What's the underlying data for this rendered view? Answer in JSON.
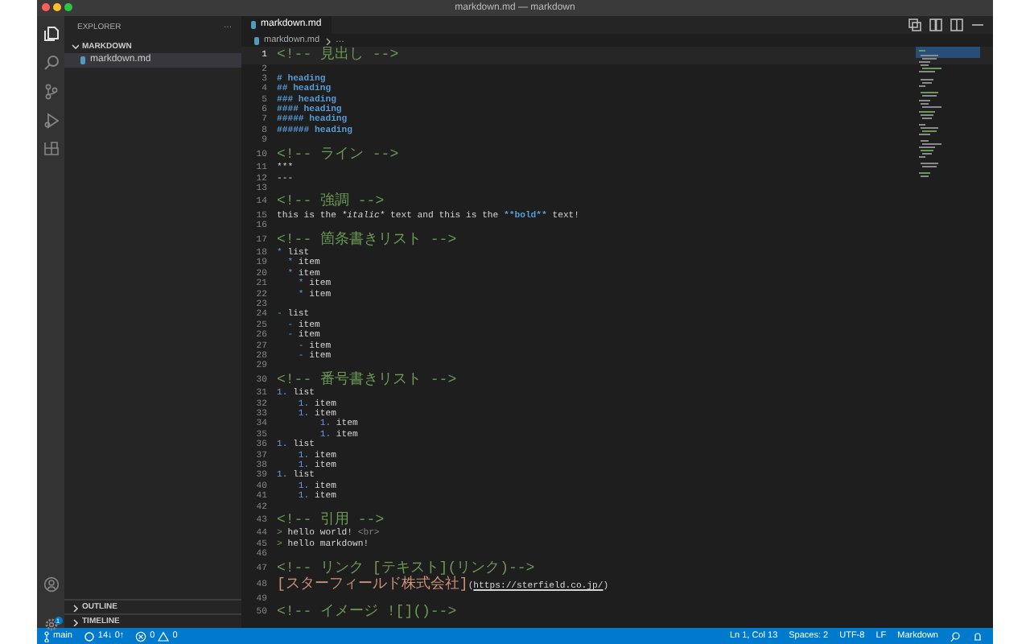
{
  "window": {
    "title": "markdown.md — markdown"
  },
  "activity_bar": {
    "items": [
      {
        "kind": "files",
        "selected": true
      },
      {
        "kind": "search",
        "selected": false
      },
      {
        "kind": "source-control",
        "selected": false
      },
      {
        "kind": "run",
        "selected": false
      },
      {
        "kind": "extensions",
        "selected": false
      }
    ],
    "settings_badge": "1"
  },
  "sidebar": {
    "title": "EXPLORER",
    "more": "···",
    "folder": {
      "label": "MARKDOWN",
      "expanded": true,
      "files": [
        {
          "name": "markdown.md",
          "selected": true
        }
      ]
    },
    "sections": [
      {
        "label": "OUTLINE",
        "expanded": false
      },
      {
        "label": "TIMELINE",
        "expanded": false
      }
    ]
  },
  "editor": {
    "tab": {
      "label": "markdown.md"
    },
    "breadcrumb": [
      "markdown.md",
      "…"
    ],
    "lines": [
      {
        "number": "1",
        "current": true,
        "segments": [
          {
            "kind": "comment",
            "text": "<!-- 見出し -->"
          }
        ]
      },
      {
        "number": "2",
        "current": false
      },
      {
        "number": "3",
        "current": false,
        "segments": [
          {
            "kind": "heading",
            "text": "# heading"
          }
        ]
      },
      {
        "number": "4",
        "current": false,
        "segments": [
          {
            "kind": "heading",
            "text": "## heading"
          }
        ]
      },
      {
        "number": "5",
        "current": false,
        "segments": [
          {
            "kind": "heading",
            "text": "### heading"
          }
        ]
      },
      {
        "number": "6",
        "current": false,
        "segments": [
          {
            "kind": "heading",
            "text": "#### heading"
          }
        ]
      },
      {
        "number": "7",
        "current": false,
        "segments": [
          {
            "kind": "heading",
            "text": "##### heading"
          }
        ]
      },
      {
        "number": "8",
        "current": false,
        "segments": [
          {
            "kind": "heading",
            "text": "###### heading"
          }
        ]
      },
      {
        "number": "9",
        "current": false
      },
      {
        "number": "10",
        "current": false,
        "segments": [
          {
            "kind": "comment",
            "text": "<!-- ライン -->"
          }
        ]
      },
      {
        "number": "11",
        "current": false,
        "segments": [
          {
            "kind": "text",
            "text": "***"
          }
        ]
      },
      {
        "number": "12",
        "current": false,
        "segments": [
          {
            "kind": "text",
            "text": "---"
          }
        ]
      },
      {
        "number": "13",
        "current": false
      },
      {
        "number": "14",
        "current": false,
        "segments": [
          {
            "kind": "comment",
            "text": "<!-- 強調 -->"
          }
        ]
      },
      {
        "number": "15",
        "current": false,
        "segments": [
          {
            "kind": "text",
            "text": "this is the "
          },
          {
            "kind": "italic",
            "text": "*italic*"
          },
          {
            "kind": "text",
            "text": " text and this is the "
          },
          {
            "kind": "bold",
            "text": "**bold**"
          },
          {
            "kind": "text",
            "text": " text!"
          }
        ]
      },
      {
        "number": "16",
        "current": false
      },
      {
        "number": "17",
        "current": false,
        "segments": [
          {
            "kind": "comment",
            "text": "<!-- 箇条書きリスト -->"
          }
        ]
      },
      {
        "number": "18",
        "current": false,
        "segments": [
          {
            "kind": "marker",
            "text": "*"
          },
          {
            "kind": "text",
            "text": " list"
          }
        ]
      },
      {
        "number": "19",
        "current": false,
        "segments": [
          {
            "kind": "marker",
            "text": "  *"
          },
          {
            "kind": "text",
            "text": " item"
          }
        ]
      },
      {
        "number": "20",
        "current": false,
        "segments": [
          {
            "kind": "marker",
            "text": "  *"
          },
          {
            "kind": "text",
            "text": " item"
          }
        ]
      },
      {
        "number": "21",
        "current": false,
        "segments": [
          {
            "kind": "marker",
            "text": "    *"
          },
          {
            "kind": "text",
            "text": " item"
          }
        ]
      },
      {
        "number": "22",
        "current": false,
        "segments": [
          {
            "kind": "marker",
            "text": "    *"
          },
          {
            "kind": "text",
            "text": " item"
          }
        ]
      },
      {
        "number": "23",
        "current": false
      },
      {
        "number": "24",
        "current": false,
        "segments": [
          {
            "kind": "marker",
            "text": "-"
          },
          {
            "kind": "text",
            "text": " list"
          }
        ]
      },
      {
        "number": "25",
        "current": false,
        "segments": [
          {
            "kind": "marker",
            "text": "  -"
          },
          {
            "kind": "text",
            "text": " item"
          }
        ]
      },
      {
        "number": "26",
        "current": false,
        "segments": [
          {
            "kind": "marker",
            "text": "  -"
          },
          {
            "kind": "text",
            "text": " item"
          }
        ]
      },
      {
        "number": "27",
        "current": false,
        "segments": [
          {
            "kind": "marker",
            "text": "    -"
          },
          {
            "kind": "text",
            "text": " item"
          }
        ]
      },
      {
        "number": "28",
        "current": false,
        "segments": [
          {
            "kind": "marker",
            "text": "    -"
          },
          {
            "kind": "text",
            "text": " item"
          }
        ]
      },
      {
        "number": "29",
        "current": false
      },
      {
        "number": "30",
        "current": false,
        "segments": [
          {
            "kind": "comment",
            "text": "<!-- 番号書きリスト -->"
          }
        ]
      },
      {
        "number": "31",
        "current": false,
        "segments": [
          {
            "kind": "marker",
            "text": "1."
          },
          {
            "kind": "text",
            "text": " list"
          }
        ]
      },
      {
        "number": "32",
        "current": false,
        "segments": [
          {
            "kind": "marker",
            "text": "    1."
          },
          {
            "kind": "text",
            "text": " item"
          }
        ]
      },
      {
        "number": "33",
        "current": false,
        "segments": [
          {
            "kind": "marker",
            "text": "    1."
          },
          {
            "kind": "text",
            "text": " item"
          }
        ]
      },
      {
        "number": "34",
        "current": false,
        "segments": [
          {
            "kind": "marker",
            "text": "        1."
          },
          {
            "kind": "text",
            "text": " item"
          }
        ]
      },
      {
        "number": "35",
        "current": false,
        "segments": [
          {
            "kind": "marker",
            "text": "        1."
          },
          {
            "kind": "text",
            "text": " item"
          }
        ]
      },
      {
        "number": "36",
        "current": false,
        "segments": [
          {
            "kind": "marker",
            "text": "1."
          },
          {
            "kind": "text",
            "text": " list"
          }
        ]
      },
      {
        "number": "37",
        "current": false,
        "segments": [
          {
            "kind": "marker",
            "text": "    1."
          },
          {
            "kind": "text",
            "text": " item"
          }
        ]
      },
      {
        "number": "38",
        "current": false,
        "segments": [
          {
            "kind": "marker",
            "text": "    1."
          },
          {
            "kind": "text",
            "text": " item"
          }
        ]
      },
      {
        "number": "39",
        "current": false,
        "segments": [
          {
            "kind": "marker",
            "text": "1."
          },
          {
            "kind": "text",
            "text": " list"
          }
        ]
      },
      {
        "number": "40",
        "current": false,
        "segments": [
          {
            "kind": "marker",
            "text": "    1."
          },
          {
            "kind": "text",
            "text": " item"
          }
        ]
      },
      {
        "number": "41",
        "current": false,
        "segments": [
          {
            "kind": "marker",
            "text": "    1."
          },
          {
            "kind": "text",
            "text": " item"
          }
        ]
      },
      {
        "number": "42",
        "current": false
      },
      {
        "number": "43",
        "current": false,
        "segments": [
          {
            "kind": "comment",
            "text": "<!-- 引用 -->"
          }
        ]
      },
      {
        "number": "44",
        "current": false,
        "segments": [
          {
            "kind": "quote",
            "text": ">"
          },
          {
            "kind": "text",
            "text": " hello world! "
          },
          {
            "kind": "tag",
            "text": "<br>"
          }
        ]
      },
      {
        "number": "45",
        "current": false,
        "segments": [
          {
            "kind": "quote",
            "text": ">"
          },
          {
            "kind": "text",
            "text": " hello markdown!"
          }
        ]
      },
      {
        "number": "46",
        "current": false
      },
      {
        "number": "47",
        "current": false,
        "segments": [
          {
            "kind": "comment",
            "text": "<!-- リンク [テキスト](リンク)-->"
          }
        ]
      },
      {
        "number": "48",
        "current": false,
        "segments": [
          {
            "kind": "link-text",
            "text": "[スターフィールド株式会社]"
          },
          {
            "kind": "text",
            "text": "("
          },
          {
            "kind": "url",
            "text": "https://sterfield.co.jp/"
          },
          {
            "kind": "text",
            "text": ")"
          }
        ]
      },
      {
        "number": "49",
        "current": false
      },
      {
        "number": "50",
        "current": false,
        "segments": [
          {
            "kind": "comment",
            "text": "<!-- イメージ ![]()-->"
          }
        ]
      }
    ]
  },
  "status_bar": {
    "branch": "main",
    "sync": "14↓ 0↑",
    "errors": "0",
    "warnings": "0",
    "right": [
      "Ln 1, Col 13",
      "Spaces: 2",
      "UTF-8",
      "LF",
      "Markdown"
    ]
  }
}
